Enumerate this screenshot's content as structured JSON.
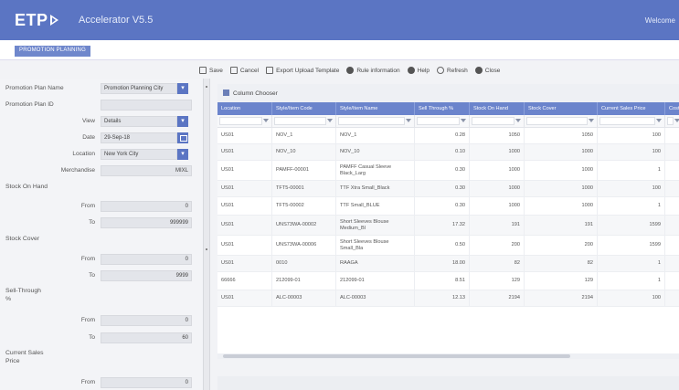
{
  "header": {
    "logo": "ETP",
    "app_name": "Accelerator V5.5",
    "welcome": "Welcome"
  },
  "module_tab": "PROMOTION PLANNING",
  "toolbar": [
    {
      "label": "Save",
      "icon": "save-icon"
    },
    {
      "label": "Cancel",
      "icon": "cancel-icon"
    },
    {
      "label": "Export Upload Template",
      "icon": "export-icon"
    },
    {
      "label": "Rule information",
      "icon": "info-icon"
    },
    {
      "label": "Help",
      "icon": "help-icon"
    },
    {
      "label": "Refresh",
      "icon": "refresh-icon"
    },
    {
      "label": "Close",
      "icon": "close-icon"
    }
  ],
  "form": {
    "plan_name_label": "Promotion Plan Name",
    "plan_name_value": "Promotion Planning City",
    "plan_id_label": "Promotion Plan ID",
    "plan_id_value": "",
    "view_label": "View",
    "view_value": "Details",
    "date_label": "Date",
    "date_value": "29-Sep-18",
    "location_label": "Location",
    "location_value": "New York City",
    "merchandise_label": "Merchandise",
    "merchandise_value": "MIXL",
    "stock_on_hand_label": "Stock On Hand",
    "soh_from": "0",
    "soh_to": "999999",
    "stock_cover_label": "Stock Cover",
    "sc_from": "0",
    "sc_to": "9999",
    "sell_through_label": "Sell-Through %",
    "st_from": "0",
    "st_to": "60",
    "current_sales_price_label": "Current Sales Price",
    "csp_from": "0",
    "from_label": "From",
    "to_label": "To"
  },
  "grid": {
    "column_chooser": "Column Chooser",
    "columns": [
      "Location",
      "Style/Item Code",
      "Style/Item Name",
      "Sell Through %",
      "Stock On Hand",
      "Stock Cover",
      "Current Sales Price",
      "Cost"
    ],
    "rows": [
      [
        "US01",
        "NOV_1",
        "NOV_1",
        "0.28",
        "1050",
        "1050",
        "100",
        ""
      ],
      [
        "US01",
        "NOV_10",
        "NOV_10",
        "0.10",
        "1000",
        "1000",
        "100",
        ""
      ],
      [
        "US01",
        "PAMFF-00001",
        "PAMFF Casual Sleeve Black_Larg",
        "0.30",
        "1000",
        "1000",
        "1",
        ""
      ],
      [
        "US01",
        "TFT5-00001",
        "TTF Xtra Small_Black",
        "0.30",
        "1000",
        "1000",
        "100",
        ""
      ],
      [
        "US01",
        "TFT5-00002",
        "TTF Small_BLUE",
        "0.30",
        "1000",
        "1000",
        "1",
        ""
      ],
      [
        "US01",
        "UNS73WA-00002",
        "Short Sleeves Blouse Medium_Bl",
        "17.32",
        "191",
        "191",
        "1599",
        ""
      ],
      [
        "US01",
        "UNS73WA-00006",
        "Short Sleeves Blouse Small_Bla",
        "0.50",
        "200",
        "200",
        "1599",
        ""
      ],
      [
        "US01",
        "0010",
        "RAAGA",
        "18.00",
        "82",
        "82",
        "1",
        ""
      ],
      [
        "66666",
        "212099-01",
        "212099-01",
        "8.51",
        "129",
        "129",
        "1",
        ""
      ],
      [
        "US01",
        "ALC-00003",
        "ALC-00003",
        "12.13",
        "2194",
        "2194",
        "100",
        ""
      ]
    ]
  },
  "colors": {
    "primary": "#5b75c3",
    "grid_header": "#6b84cc",
    "panel_bg": "#f3f4f7"
  }
}
